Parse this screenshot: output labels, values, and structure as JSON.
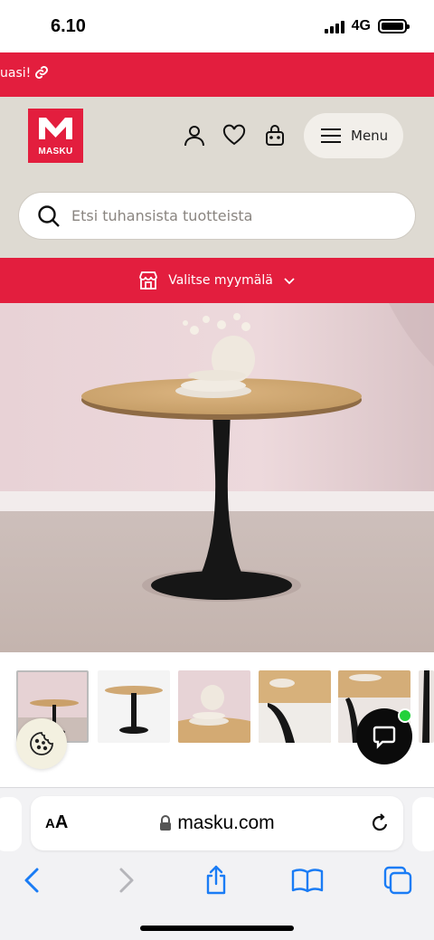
{
  "status_bar": {
    "time": "6.10",
    "network": "4G"
  },
  "promo": {
    "text": "uasi!"
  },
  "header": {
    "logo_text": "MASKU",
    "menu_label": "Menu",
    "icons": [
      "user-icon",
      "heart-icon",
      "shopping-bag-icon",
      "hamburger-icon"
    ]
  },
  "search": {
    "placeholder": "Etsi tuhansista tuotteista"
  },
  "store": {
    "label": "Valitse myymälä"
  },
  "gallery": {
    "thumbnail_count": 6,
    "active_index": 0
  },
  "browser": {
    "aa_label": "AA",
    "url": "masku.com",
    "nav_icons": [
      "back-icon",
      "forward-icon",
      "share-icon",
      "bookmarks-icon",
      "tabs-icon"
    ]
  },
  "colors": {
    "brand_red": "#e31e3e",
    "header_beige": "#dedad2",
    "safari_blue": "#1a7cf5",
    "chat_online": "#23d13b"
  }
}
